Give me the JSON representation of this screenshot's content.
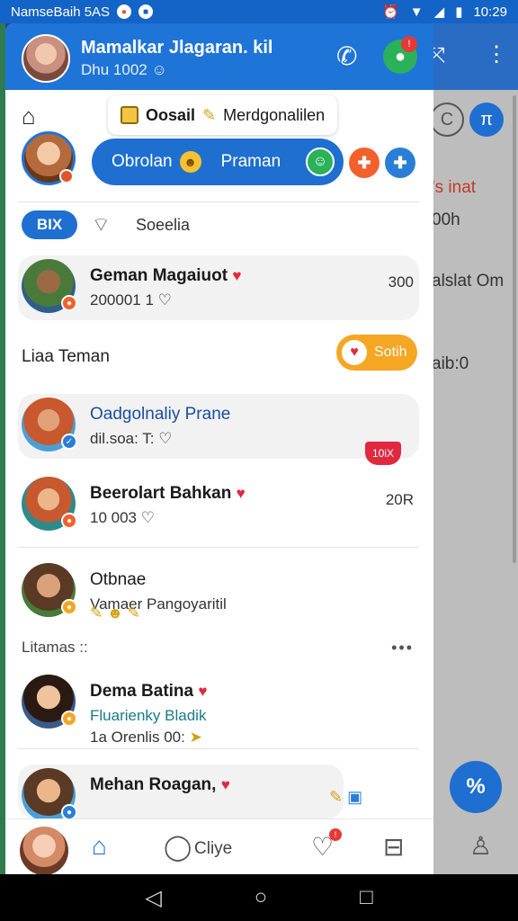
{
  "status_bar": {
    "carrier": "NamseBaih 5AS",
    "time": "10:29"
  },
  "header": {
    "title": "Mamalkar Jlagaran. kil",
    "subtitle": "Dhu 1002"
  },
  "top_chip": {
    "label": "Oosail",
    "suffix": "Merdgonalilen"
  },
  "story": {
    "pill_left": "Obrolan",
    "pill_right": "Praman"
  },
  "filters": {
    "all_label": "BIX",
    "label": "Soeelia"
  },
  "section_friends": {
    "label": "Liaa Teman",
    "action_label": "Sotih"
  },
  "section_status": {
    "label": "Litamas ::",
    "more": "•••"
  },
  "contacts": [
    {
      "name": "Geman Magaiuot",
      "sub": "200001 1",
      "time": "300"
    },
    {
      "name": "Oadgolnaliy Prane",
      "sub": "dil.soa: T:",
      "badge": "10iX"
    },
    {
      "name": "Beerolart Bahkan",
      "sub": "10 003",
      "time": "20R"
    },
    {
      "name": "Otbnae",
      "sub": "Vamaer Pangoyaritil"
    },
    {
      "name": "Dema Batina",
      "sub": "Fluarienky Bladik",
      "sub2": "1a Orenlis 00:"
    },
    {
      "name": "Mehan Roagan,"
    }
  ],
  "background": {
    "label1": "'s inat",
    "label2": "00h",
    "label3": "alslat Om",
    "label4": "aib:0"
  },
  "navbar": {
    "chat_label": "Cliye"
  },
  "colors": {
    "primary": "#1f74d8",
    "accent_green": "#2bb15a",
    "accent_orange": "#f5a623",
    "heart_red": "#e0283e"
  }
}
